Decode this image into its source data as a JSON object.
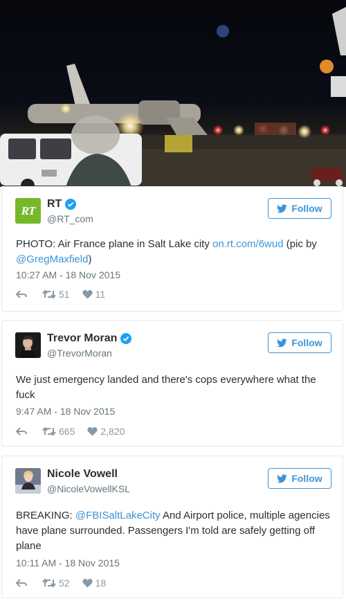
{
  "tweets": [
    {
      "name": "RT",
      "handle": "@RT_com",
      "follow_label": "Follow",
      "text_parts": [
        "PHOTO: Air France plane in Salt Lake city ",
        "on.rt.com/6wud",
        " (pic by ",
        "@GregMaxfield",
        ")"
      ],
      "timestamp": "10:27 AM - 18 Nov 2015",
      "retweets": "51",
      "likes": "11",
      "avatar_text": "RT",
      "avatar_color": "#77b82a"
    },
    {
      "name": "Trevor Moran",
      "handle": "@TrevorMoran",
      "follow_label": "Follow",
      "text": "We just emergency landed and there's cops everywhere what the fuck",
      "timestamp": "9:47 AM - 18 Nov 2015",
      "retweets": "665",
      "likes": "2,820"
    },
    {
      "name": "Nicole Vowell",
      "handle": "@NicoleVowellKSL",
      "follow_label": "Follow",
      "text_parts": [
        "BREAKING: ",
        "@FBISaltLakeCity",
        "  And Airport police, multiple agencies have plane surrounded. Passengers I'm told are safely getting off plane"
      ],
      "timestamp": "10:11 AM - 18 Nov 2015",
      "retweets": "52",
      "likes": "18"
    }
  ],
  "colors": {
    "link": "#3b94d9",
    "verified": "#1da1f2",
    "muted": "#8899a6"
  },
  "icons": [
    "reply-icon",
    "retweet-icon",
    "heart-icon",
    "twitter-bird-icon",
    "verified-badge-icon"
  ]
}
